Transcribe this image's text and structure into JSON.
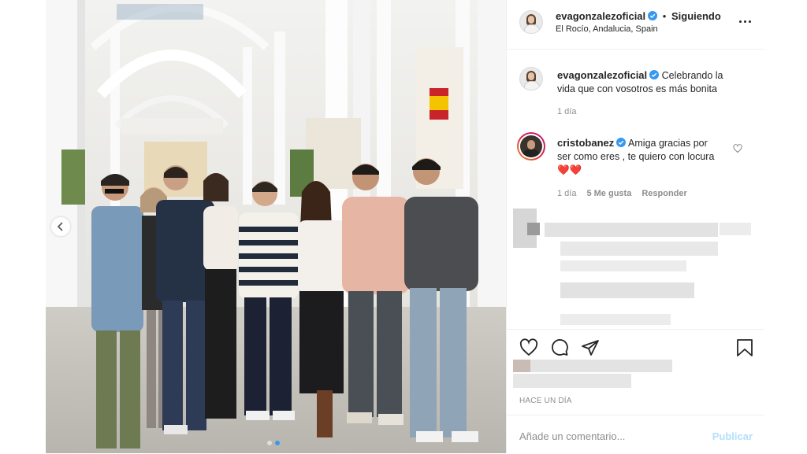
{
  "header": {
    "username": "evagonzalezofficial_hdr",
    "username_text": "evagonzalezoficial",
    "separator": "•",
    "follow_status": "Siguiendo",
    "location": "El Rocío, Andalucia, Spain"
  },
  "caption": {
    "username": "evagonzalezoficial",
    "text": "Celebrando la vida que con vosotros es más bonita",
    "time": "1 día"
  },
  "comment": {
    "username": "cristobanez",
    "text": "Amiga gracias por ser como eres , te quiero con locura",
    "hearts": "❤️❤️",
    "time": "1 día",
    "likes": "5 Me gusta",
    "reply": "Responder"
  },
  "post": {
    "time_ago": "HACE UN DÍA",
    "add_comment_placeholder": "Añade un comentario...",
    "publish_label": "Publicar"
  },
  "carousel": {
    "current": 2,
    "total": 2
  },
  "colors": {
    "verified": "#3897f0",
    "link_disabled": "#b2dffc",
    "meta": "#8e8e8e"
  }
}
